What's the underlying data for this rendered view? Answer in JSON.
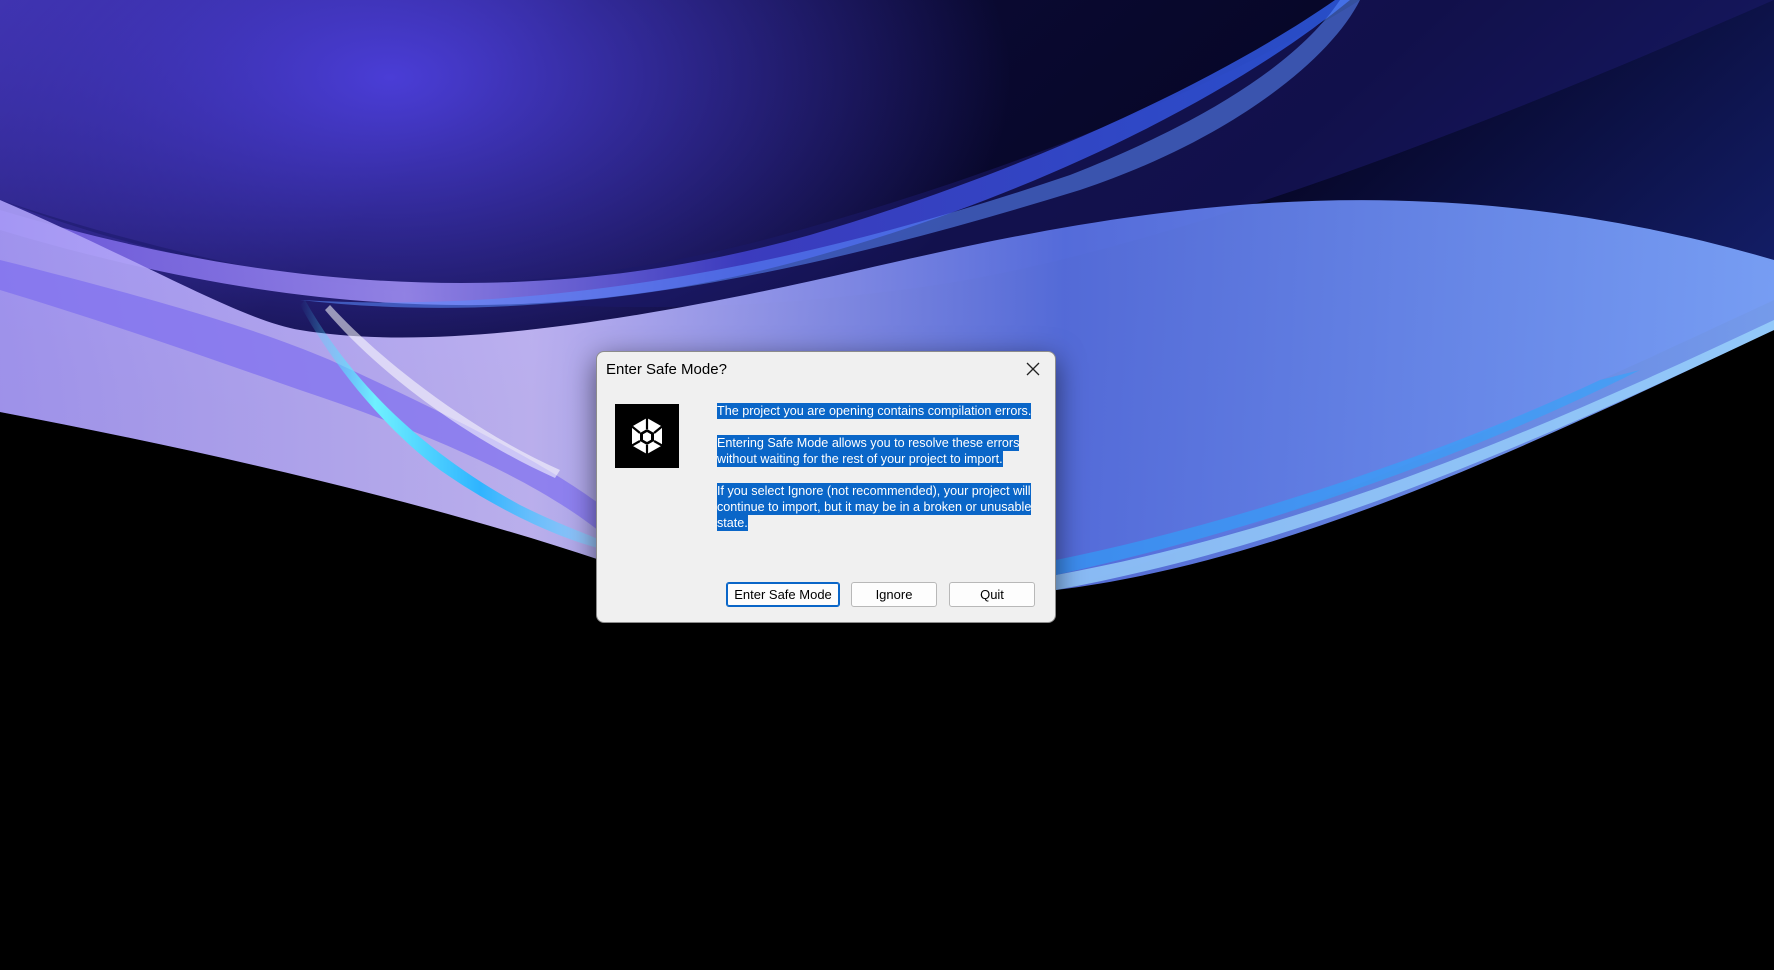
{
  "dialog": {
    "title": "Enter Safe Mode?",
    "close_icon": "close-icon",
    "logo_icon": "unity-logo-icon",
    "paragraphs": [
      "The project you are opening contains compilation errors.",
      "Entering Safe Mode allows you to resolve these errors without waiting for the rest of your project to import.",
      "If you select Ignore (not recommended), your project will continue to import, but it may be in a broken or unusable state."
    ],
    "buttons": {
      "enter_safe_mode": "Enter Safe Mode",
      "ignore": "Ignore",
      "quit": "Quit"
    },
    "selection_color": "#0a66c8",
    "background_color": "#f0f0f0"
  },
  "desktop": {
    "wallpaper": "abstract-blue-purple-wave"
  }
}
